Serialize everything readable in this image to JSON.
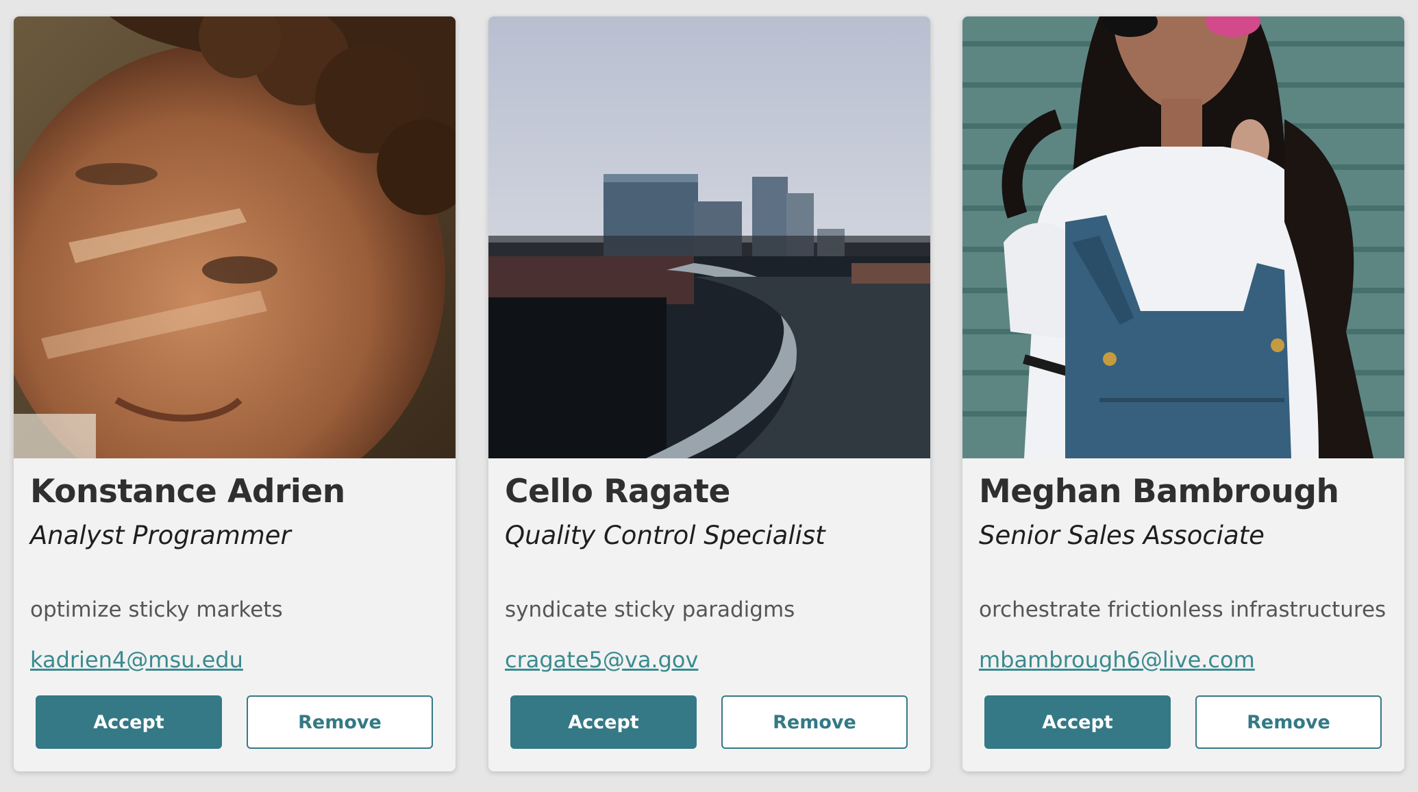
{
  "colors": {
    "background": "#e6e6e6",
    "card": "#f2f2f2",
    "accent": "#347985",
    "link": "#3a8a8f"
  },
  "cards": [
    {
      "name": "Konstance Adrien",
      "title": "Analyst Programmer",
      "description": "optimize sticky markets",
      "email": "kadrien4@msu.edu",
      "accept_label": "Accept",
      "remove_label": "Remove",
      "photo_icon": "portrait-photo"
    },
    {
      "name": "Cello Ragate",
      "title": "Quality Control Specialist",
      "description": "syndicate sticky paradigms",
      "email": "cragate5@va.gov",
      "accept_label": "Accept",
      "remove_label": "Remove",
      "photo_icon": "cityscape-photo"
    },
    {
      "name": "Meghan Bambrough",
      "title": "Senior Sales Associate",
      "description": "orchestrate frictionless infrastructures",
      "email": "mbambrough6@live.com",
      "accept_label": "Accept",
      "remove_label": "Remove",
      "photo_icon": "portrait-photo"
    }
  ]
}
